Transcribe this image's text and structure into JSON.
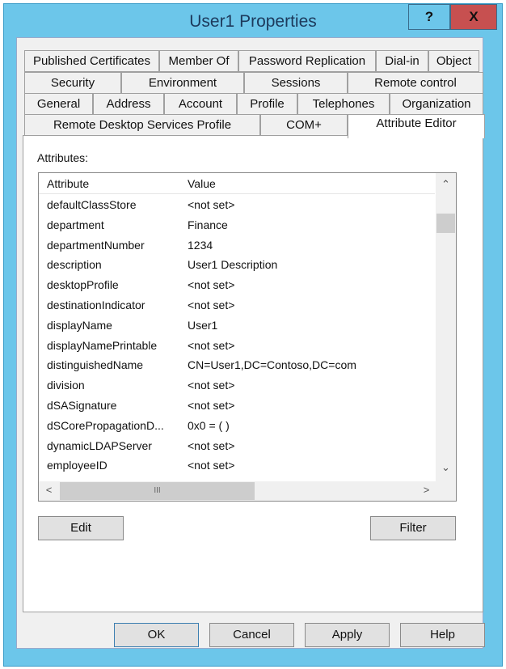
{
  "window": {
    "title": "User1 Properties",
    "help_label": "?",
    "close_label": "X"
  },
  "tabs": {
    "row1": [
      "Published Certificates",
      "Member Of",
      "Password Replication",
      "Dial-in",
      "Object"
    ],
    "row2": [
      "Security",
      "Environment",
      "Sessions",
      "Remote control"
    ],
    "row3": [
      "General",
      "Address",
      "Account",
      "Profile",
      "Telephones",
      "Organization"
    ],
    "row4": [
      "Remote Desktop Services Profile",
      "COM+",
      "Attribute Editor"
    ],
    "selected": "Attribute Editor"
  },
  "attributes": {
    "label": "Attributes:",
    "columns": [
      "Attribute",
      "Value"
    ],
    "rows": [
      [
        "defaultClassStore",
        "<not set>"
      ],
      [
        "department",
        "Finance"
      ],
      [
        "departmentNumber",
        "1234"
      ],
      [
        "description",
        "User1 Description"
      ],
      [
        "desktopProfile",
        "<not set>"
      ],
      [
        "destinationIndicator",
        "<not set>"
      ],
      [
        "displayName",
        "User1"
      ],
      [
        "displayNamePrintable",
        "<not set>"
      ],
      [
        "distinguishedName",
        "CN=User1,DC=Contoso,DC=com"
      ],
      [
        "division",
        "<not set>"
      ],
      [
        "dSASignature",
        "<not set>"
      ],
      [
        "dSCorePropagationD...",
        "0x0 = ( )"
      ],
      [
        "dynamicLDAPServer",
        "<not set>"
      ],
      [
        "employeeID",
        "<not set>"
      ]
    ],
    "hscroll_grip": "III"
  },
  "buttons": {
    "edit": "Edit",
    "filter": "Filter",
    "ok": "OK",
    "cancel": "Cancel",
    "apply": "Apply",
    "help": "Help"
  }
}
